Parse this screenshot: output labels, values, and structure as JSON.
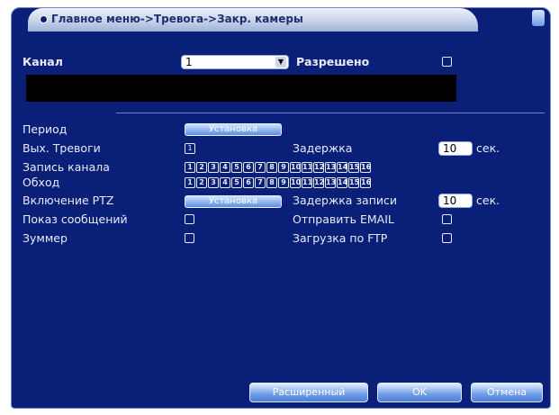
{
  "window": {
    "title": "Главное меню->Тревога->Закр. камеры"
  },
  "channel": {
    "label": "Канал",
    "value": "1",
    "enabled_label": "Разрешено"
  },
  "period": {
    "label": "Период",
    "button": "Установка"
  },
  "alarm_out": {
    "label": "Вых. Тревоги",
    "value": "1",
    "delay_label": "Задержка",
    "delay_value": "10",
    "unit": "сек."
  },
  "record_channel": {
    "label": "Запись канала"
  },
  "tour": {
    "label": "Обход"
  },
  "channels": [
    "1",
    "2",
    "3",
    "4",
    "5",
    "6",
    "7",
    "8",
    "9",
    "10",
    "11",
    "12",
    "13",
    "14",
    "15",
    "16"
  ],
  "ptz": {
    "label": "Включение PTZ",
    "button": "Установка",
    "record_delay_label": "Задержка записи",
    "record_delay_value": "10",
    "unit": "сек."
  },
  "options": {
    "show_message": "Показ сообщений",
    "send_email": "Отправить EMAIL",
    "buzzer": "Зуммер",
    "ftp_upload": "Загрузка по FTP"
  },
  "buttons": {
    "advanced": "Расширенный",
    "ok": "OK",
    "cancel": "Отмена"
  },
  "colors": {
    "panel": "#0a1f78",
    "accent": "#5b8fe0"
  }
}
